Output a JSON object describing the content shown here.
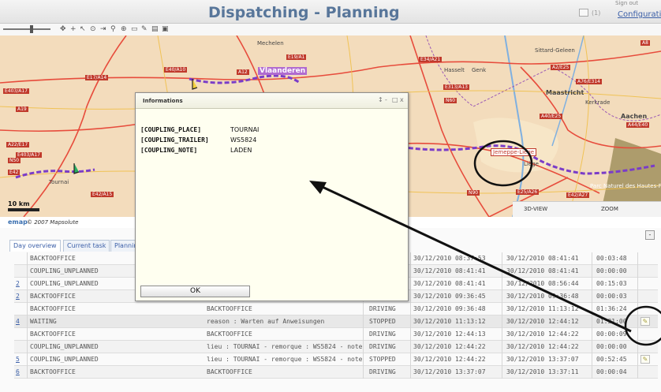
{
  "header": {
    "title": "Dispatching - Planning",
    "top_right_small": "Sign out",
    "configuration": "Configuratio",
    "message_count": "(1)"
  },
  "toolbar": {
    "icons": [
      "pan-icon",
      "zoom-in-icon",
      "zoom-out-icon",
      "center-icon",
      "route-icon",
      "ruler-icon",
      "layers-icon",
      "poi-icon",
      "print-icon",
      "save-icon"
    ]
  },
  "map": {
    "cities": [
      "Mechelen",
      "Maastricht",
      "Aachen",
      "Sittard-Geleen",
      "Hasselt",
      "Genk",
      "Liège",
      "Kerkrade",
      "Tournai",
      "Vlaanderen"
    ],
    "highlight_label": "Jemeppe-Liège",
    "roads": [
      "E19/A1",
      "E34/A21",
      "E40/A10",
      "A12",
      "E17/A14",
      "E403/A17",
      "A19",
      "E313/A13",
      "A2/E25",
      "E25/A26",
      "E42/A15",
      "E42/A27",
      "A76/E314",
      "A44/E40",
      "A40/E25",
      "N60",
      "N90",
      "A22/E17",
      "E403/A17",
      "N50",
      "E42",
      "A8"
    ],
    "belgium_label": "Parc Naturel des Hautes-Fagnes",
    "scale": "10 km",
    "view_3d": "3D-VIEW",
    "view_zoom": "ZOOM"
  },
  "copyright": {
    "logo": "emap",
    "text": "© 2007 Mapsolute"
  },
  "tabs": [
    {
      "label": "Day overview",
      "active": true
    },
    {
      "label": "Current task",
      "active": false
    },
    {
      "label": "Planning",
      "active": false
    }
  ],
  "rows": [
    {
      "link": "",
      "type": "BACKTOOFFICE",
      "desc": "",
      "status": "",
      "start": "30/12/2010 08:37:53",
      "end": "30/12/2010 08:41:41",
      "dur": "00:03:48",
      "edit": false
    },
    {
      "link": "",
      "type": "COUPLING_UNPLANNED",
      "desc": "",
      "status": "",
      "start": "30/12/2010 08:41:41",
      "end": "30/12/2010 08:41:41",
      "dur": "00:00:00",
      "edit": false
    },
    {
      "link": "2",
      "type": "COUPLING_UNPLANNED",
      "desc": "",
      "status": "",
      "start": "30/12/2010 08:41:41",
      "end": "30/12/2010 08:56:44",
      "dur": "00:15:03",
      "edit": false
    },
    {
      "link": "2",
      "type": "BACKTOOFFICE",
      "desc": "",
      "status": "",
      "start": "30/12/2010 09:36:45",
      "end": "30/12/2010 09:36:48",
      "dur": "00:00:03",
      "edit": false
    },
    {
      "link": "",
      "type": "BACKTOOFFICE",
      "desc": "BACKTOOFFICE",
      "status": "DRIVING",
      "start": "30/12/2010 09:36:48",
      "end": "30/12/2010 11:13:12",
      "dur": "01:36:24",
      "edit": false
    },
    {
      "link": "4",
      "type": "WAITING",
      "desc": "reason : Warten auf Anweisungen",
      "status": "STOPPED",
      "start": "30/12/2010 11:13:12",
      "end": "30/12/2010 12:44:12",
      "dur": "01:31:00",
      "edit": true
    },
    {
      "link": "",
      "type": "BACKTOOFFICE",
      "desc": "BACKTOOFFICE",
      "status": "DRIVING",
      "start": "30/12/2010 12:44:13",
      "end": "30/12/2010 12:44:22",
      "dur": "00:00:09",
      "edit": false
    },
    {
      "link": "",
      "type": "COUPLING_UNPLANNED",
      "desc": "lieu : TOURNAI - remorque : WS5824 - note : LADEN",
      "status": "DRIVING",
      "start": "30/12/2010 12:44:22",
      "end": "30/12/2010 12:44:22",
      "dur": "00:00:00",
      "edit": false
    },
    {
      "link": "5",
      "type": "COUPLING_UNPLANNED",
      "desc": "lieu : TOURNAI - remorque : WS5824 - note : LADEN",
      "status": "STOPPED",
      "start": "30/12/2010 12:44:22",
      "end": "30/12/2010 13:37:07",
      "dur": "00:52:45",
      "edit": true
    },
    {
      "link": "6",
      "type": "BACKTOOFFICE",
      "desc": "BACKTOOFFICE",
      "status": "DRIVING",
      "start": "30/12/2010 13:37:07",
      "end": "30/12/2010 13:37:11",
      "dur": "00:00:04",
      "edit": false
    }
  ],
  "popup": {
    "title": "Informations",
    "controls": [
      "↕",
      "-",
      "□",
      "x"
    ],
    "fields": [
      {
        "key": "[COUPLING_PLACE]",
        "value": "TOURNAI"
      },
      {
        "key": "[COUPLING_TRAILER]",
        "value": "WS5824"
      },
      {
        "key": "[COUPLING_NOTE]",
        "value": "LADEN"
      }
    ],
    "ok": "OK"
  },
  "colors": {
    "title": "#58769a",
    "route": "#7a3cc8",
    "map_bg": "#f2d9b8",
    "popup_bg": "#fffff0"
  }
}
